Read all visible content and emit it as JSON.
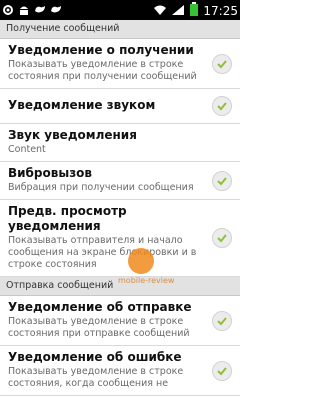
{
  "statusbar": {
    "time": "17:25"
  },
  "sections": [
    {
      "label": "Получение сообщений"
    },
    {
      "label": "Отправка сообщений"
    }
  ],
  "rows": [
    {
      "title": "Уведомление о получении",
      "summary": "Показывать уведомление в строке состояния при получении сообщений",
      "checked": true
    },
    {
      "title": "Уведомление звуком",
      "summary": "",
      "checked": true
    },
    {
      "title": "Звук уведомления",
      "summary": "Content",
      "checked": false
    },
    {
      "title": "Вибровызов",
      "summary": "Вибрация при получении сообщения",
      "checked": true
    },
    {
      "title": "Предв. просмотр уведомления",
      "summary": "Показывать отправителя и начало сообщения на экране блокировки и в строке состояния",
      "checked": true
    },
    {
      "title": "Уведомление об отправке",
      "summary": "Показывать уведомление в строке состояния при отправке сообщений",
      "checked": true
    },
    {
      "title": "Уведомление об ошибке",
      "summary": "Показывать уведомление в строке состояния, когда сообщения не",
      "checked": true
    }
  ],
  "watermark": {
    "text": "mobile-review"
  },
  "colors": {
    "check": "#8fbf3a",
    "statusbar": "#000000",
    "section_bg": "#e2e2e2"
  }
}
